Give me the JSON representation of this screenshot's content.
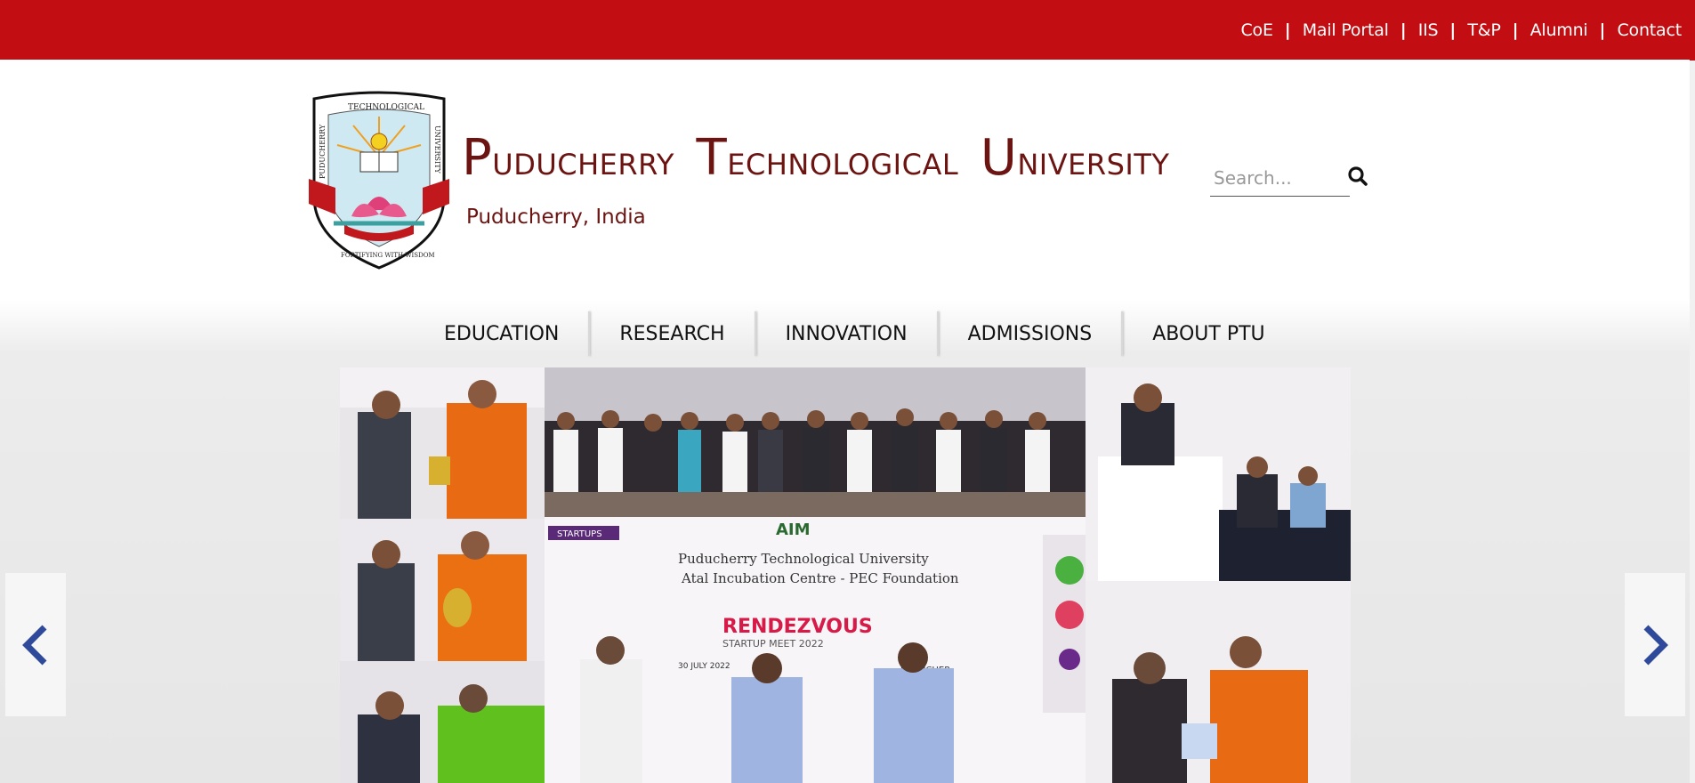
{
  "top_links": [
    {
      "label": "CoE"
    },
    {
      "label": "Mail Portal"
    },
    {
      "label": "IIS"
    },
    {
      "label": "T&P"
    },
    {
      "label": "Alumni"
    },
    {
      "label": "Contact"
    }
  ],
  "header": {
    "title_words": [
      {
        "initial": "P",
        "rest": "UDUCHERRY"
      },
      {
        "initial": "T",
        "rest": "ECHNOLOGICAL"
      },
      {
        "initial": "U",
        "rest": "NIVERSITY"
      }
    ],
    "subtitle": "Puducherry, India",
    "logo_text_left": "PUDUCHERRY",
    "logo_text_top": "TECHNOLOGICAL",
    "logo_text_right": "UNIVERSITY",
    "logo_motto": "FORTIFYING WITH WISDOM"
  },
  "search": {
    "placeholder": "Search..."
  },
  "nav": [
    {
      "label": "EDUCATION"
    },
    {
      "label": "RESEARCH"
    },
    {
      "label": "INNOVATION"
    },
    {
      "label": "ADMISSIONS"
    },
    {
      "label": "ABOUT PTU"
    }
  ],
  "slider": {
    "prev_icon": "chevron-left-icon",
    "next_icon": "chevron-right-icon",
    "banner_line1": "Puducherry Technological University",
    "banner_line2": "Atal Incubation Centre - PEC Foundation",
    "event_name": "RENDEZVOUS",
    "event_sub": "STARTUP MEET 2022",
    "date_text": "30 JULY 2022",
    "tag_startups": "STARTUPS",
    "tag_aim": "AIM",
    "tag_puducher": "PUDUCHER"
  },
  "colors": {
    "brand_red": "#c20e12",
    "title_maroon": "#6b1411",
    "arrow_blue": "#2f4a9a"
  }
}
